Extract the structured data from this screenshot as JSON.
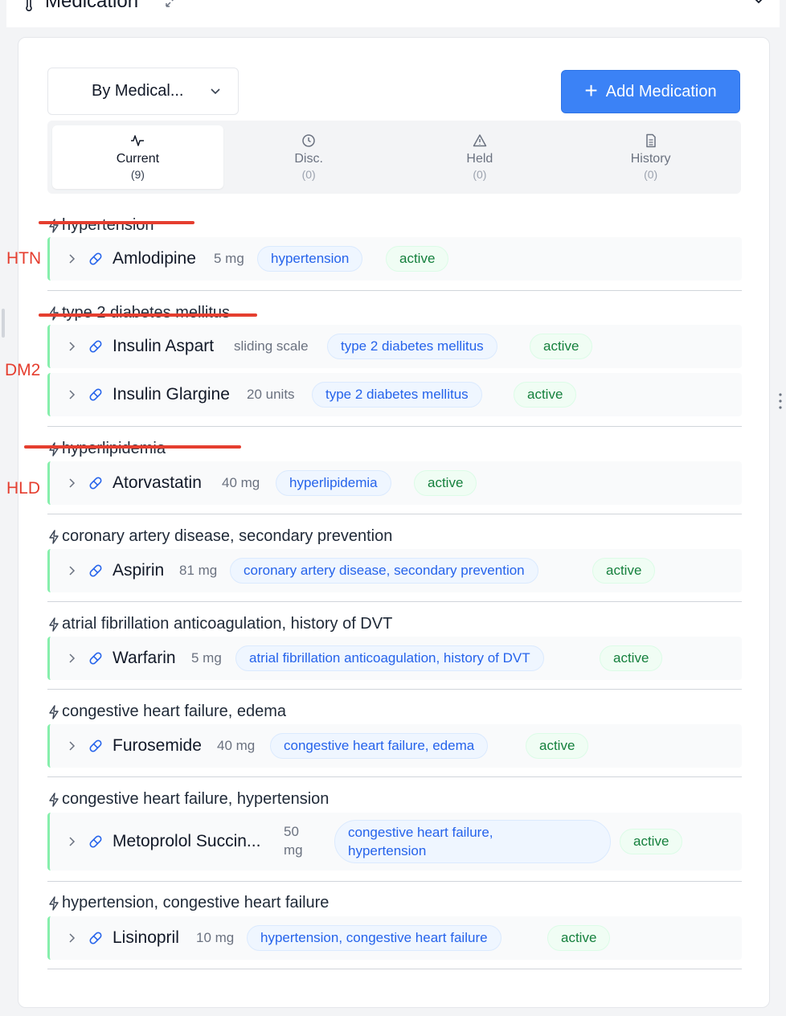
{
  "header": {
    "title": "Medication"
  },
  "toolbar": {
    "group_by_value": "By Medical...",
    "add_label": "Add Medication"
  },
  "tabs": [
    {
      "label": "Current",
      "count": "(9)"
    },
    {
      "label": "Disc.",
      "count": "(0)"
    },
    {
      "label": "Held",
      "count": "(0)"
    },
    {
      "label": "History",
      "count": "(0)"
    }
  ],
  "groups": [
    {
      "title": "hypertension",
      "meds": [
        {
          "name": "Amlodipine",
          "dose": "5 mg",
          "indication": "hypertension",
          "status": "active"
        }
      ]
    },
    {
      "title": "type 2 diabetes mellitus",
      "meds": [
        {
          "name": "Insulin Aspart",
          "dose": "sliding scale",
          "indication": "type 2 diabetes mellitus",
          "status": "active"
        },
        {
          "name": "Insulin Glargine",
          "dose": "20 units",
          "indication": "type 2 diabetes mellitus",
          "status": "active"
        }
      ]
    },
    {
      "title": "hyperlipidemia",
      "meds": [
        {
          "name": "Atorvastatin",
          "dose": "40 mg",
          "indication": "hyperlipidemia",
          "status": "active"
        }
      ]
    },
    {
      "title": "coronary artery disease, secondary prevention",
      "meds": [
        {
          "name": "Aspirin",
          "dose": "81 mg",
          "indication": "coronary artery disease, secondary prevention",
          "status": "active"
        }
      ]
    },
    {
      "title": "atrial fibrillation anticoagulation, history of DVT",
      "meds": [
        {
          "name": "Warfarin",
          "dose": "5 mg",
          "indication": "atrial fibrillation anticoagulation, history of DVT",
          "status": "active"
        }
      ]
    },
    {
      "title": "congestive heart failure, edema",
      "meds": [
        {
          "name": "Furosemide",
          "dose": "40 mg",
          "indication": "congestive heart failure, edema",
          "status": "active"
        }
      ]
    },
    {
      "title": "congestive heart failure, hypertension",
      "meds": [
        {
          "name": "Metoprolol Succin...",
          "dose_line1": "50",
          "dose_line2": "mg",
          "indication_line1": "congestive heart failure,",
          "indication_line2": "hypertension",
          "status": "active"
        }
      ]
    },
    {
      "title": "hypertension, congestive heart failure",
      "meds": [
        {
          "name": "Lisinopril",
          "dose": "10 mg",
          "indication": "hypertension, congestive heart failure",
          "status": "active"
        }
      ]
    }
  ],
  "annotations": {
    "htn": "HTN",
    "dm2": "DM2",
    "hld": "HLD"
  },
  "colors": {
    "accent": "#3b82f6",
    "status_green": "#15803d",
    "indication_blue": "#2563eb",
    "annotation_red": "#e53e2f",
    "row_border": "#86efac"
  },
  "icons": {
    "header": "thermometer-icon",
    "expand": "expand-icon",
    "collapse": "chevron-down-icon",
    "pill": "pill-icon",
    "group": "bolt-icon",
    "row": "chevron-right-icon"
  }
}
